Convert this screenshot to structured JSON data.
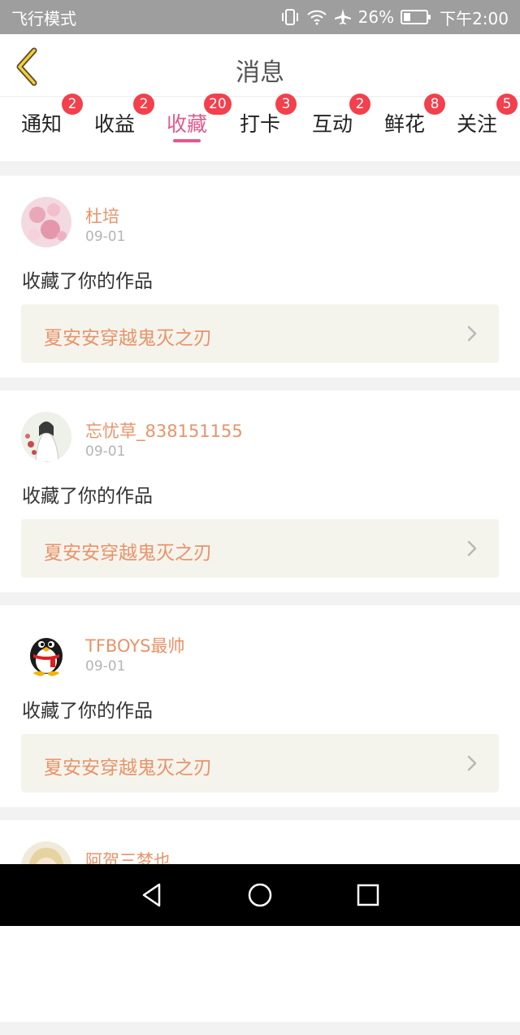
{
  "status_bar": {
    "left_text": "飞行模式",
    "battery_percent": "26%",
    "time": "下午2:00"
  },
  "header": {
    "title": "消息"
  },
  "tabs": [
    {
      "label": "通知",
      "badge": "2"
    },
    {
      "label": "收益",
      "badge": "2"
    },
    {
      "label": "收藏",
      "badge": "20",
      "active": true
    },
    {
      "label": "打卡",
      "badge": "3"
    },
    {
      "label": "互动",
      "badge": "2"
    },
    {
      "label": "鲜花",
      "badge": "8"
    },
    {
      "label": "关注",
      "badge": "5"
    }
  ],
  "feed": [
    {
      "username": "杜培",
      "date": "09-01",
      "action": "收藏了你的作品",
      "work_title": "夏安安穿越鬼灭之刃"
    },
    {
      "username": "忘忧草_838151155",
      "date": "09-01",
      "action": "收藏了你的作品",
      "work_title": "夏安安穿越鬼灭之刃"
    },
    {
      "username": "TFBOYS最帅",
      "date": "09-01",
      "action": "收藏了你的作品",
      "work_title": "夏安安穿越鬼灭之刃"
    },
    {
      "username": "阿贺三梦也"
    }
  ],
  "colors": {
    "accent_pink": "#e05a8e",
    "badge_red": "#f2404d",
    "username_orange": "#e8936a",
    "link_bg": "#f5f4ec"
  },
  "icons": {
    "back": "chevron-left-icon",
    "vibrate": "vibrate-icon",
    "wifi": "wifi-icon",
    "airplane": "airplane-icon",
    "battery": "battery-icon",
    "nav_back": "triangle-back-icon",
    "nav_home": "circle-home-icon",
    "nav_recent": "square-recent-icon"
  }
}
